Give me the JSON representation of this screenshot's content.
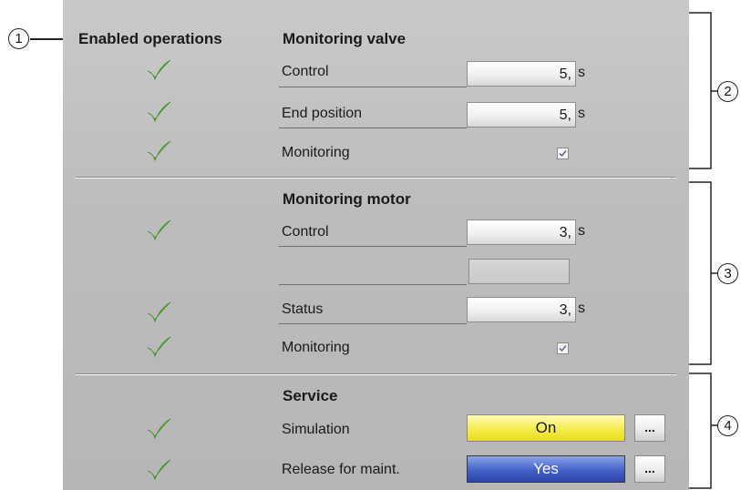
{
  "header": {
    "enabled_operations": "Enabled operations"
  },
  "callouts": [
    "1",
    "2",
    "3",
    "4"
  ],
  "valve": {
    "title": "Monitoring valve",
    "control": {
      "label": "Control",
      "value": "5,",
      "unit": "s"
    },
    "end_position": {
      "label": "End position",
      "value": "5,",
      "unit": "s"
    },
    "monitoring": {
      "label": "Monitoring",
      "checked": true
    }
  },
  "motor": {
    "title": "Monitoring motor",
    "control": {
      "label": "Control",
      "value": "3,",
      "unit": "s"
    },
    "status": {
      "label": "Status",
      "value": "3,",
      "unit": "s"
    },
    "monitoring": {
      "label": "Monitoring",
      "checked": true
    }
  },
  "service": {
    "title": "Service",
    "simulation": {
      "label": "Simulation",
      "state": "On",
      "button": "..."
    },
    "maintenance": {
      "label": "Release for maint.",
      "state": "Yes",
      "button": "..."
    }
  },
  "colors": {
    "panel": "#bdbdbd",
    "checkmark": "#66c43c",
    "simulation_on": "#f4ec4a",
    "maintenance_yes": "#4461c8"
  },
  "icons": {
    "enabled": "checkmark-icon",
    "checkbox": "checkbox-checked-icon"
  }
}
